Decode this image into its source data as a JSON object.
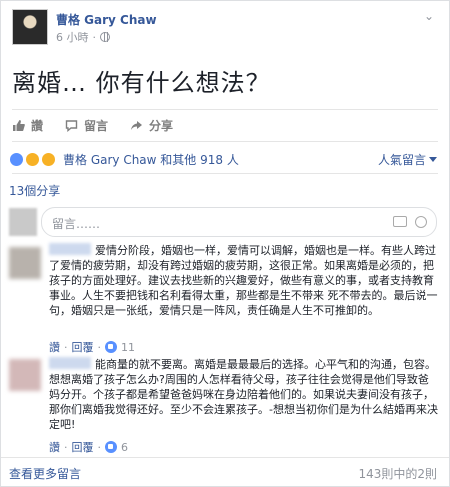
{
  "post": {
    "author": "曹格 Gary Chaw",
    "time": "6 小時",
    "text": "离婚… 你有什么想法？"
  },
  "actions": {
    "like": "讚",
    "comment": "留言",
    "share": "分享"
  },
  "reactions": {
    "summary": "曹格 Gary Chaw 和其他 918 人",
    "sort_label": "人氣留言"
  },
  "shares": "13個分享",
  "composer": {
    "placeholder": "留言……"
  },
  "comments": [
    {
      "text": "爱情分阶段，婚姻也一样，爱情可以调解，婚姻也是一样。有些人跨过了爱情的疲劳期，却没有跨过婚姻的疲劳期，这很正常。如果离婚是必须的，把孩子的方面处理好。建议去找些新的兴趣爱好，做些有意义的事，或者支持教育事业。人生不要把钱和名利看得太重，那些都是生不带来 死不带去的。最后说一句，婚姻只是一张纸，爱情只是一阵风，责任确是人生不可推卸的。",
      "like": "讚",
      "reply": "回覆",
      "count": "11"
    },
    {
      "text": "能商量的就不要离。离婚是最最最后的选择。心平气和的沟通，包容。想想离婚了孩子怎么办?周围的人怎样看待父母，孩子往往会觉得是他们导致爸妈分开。个孩子都是希望爸爸妈咪在身边陪着他们的。如果说夫妻间没有孩子，那你们离婚我觉得还好。至少不会连累孩子。-想想当初你们是为什么結婚再来决定吧!",
      "like": "讚",
      "reply": "回覆",
      "count": "6"
    }
  ],
  "footer": {
    "more": "查看更多留言",
    "pager": "143則中的2則"
  },
  "colors": {
    "link": "#365899",
    "muted": "#90949c",
    "like_blue": "#5890ff"
  }
}
